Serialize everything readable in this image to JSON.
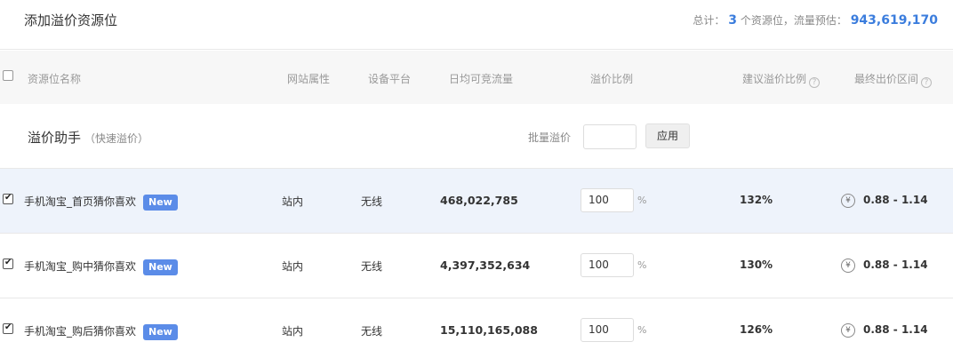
{
  "header": {
    "title": "添加溢价资源位",
    "summary_prefix": "总计：",
    "resource_count": "3",
    "summary_middle": "个资源位，流量预估：",
    "traffic_total": "943,619,170"
  },
  "table": {
    "columns": {
      "name": "资源位名称",
      "site": "网站属性",
      "platform": "设备平台",
      "daily_traffic": "日均可竞流量",
      "premium_ratio": "溢价比例",
      "suggested_ratio": "建议溢价比例",
      "final_range": "最终出价区间"
    }
  },
  "assistant": {
    "title": "溢价助手",
    "subtitle": "（快速溢价）",
    "batch_label": "批量溢价",
    "batch_value": "",
    "apply_label": "应用"
  },
  "rows": [
    {
      "name": "手机淘宝_首页猜你喜欢",
      "badge": "New",
      "site": "站内",
      "platform": "无线",
      "traffic": "468,022,785",
      "ratio": "100",
      "pct": "%",
      "suggested": "132%",
      "range": "0.88 - 1.14",
      "checked": true
    },
    {
      "name": "手机淘宝_购中猜你喜欢",
      "badge": "New",
      "site": "站内",
      "platform": "无线",
      "traffic": "4,397,352,634",
      "ratio": "100",
      "pct": "%",
      "suggested": "130%",
      "range": "0.88 - 1.14",
      "checked": true
    },
    {
      "name": "手机淘宝_购后猜你喜欢",
      "badge": "New",
      "site": "站内",
      "platform": "无线",
      "traffic": "15,110,165,088",
      "ratio": "100",
      "pct": "%",
      "suggested": "126%",
      "range": "0.88 - 1.14",
      "checked": true
    }
  ],
  "colors": {
    "accent": "#3b7ddd",
    "badge": "#5b8ce8",
    "highlight_row": "#eef3fb"
  },
  "icons": {
    "help": "help-circle-icon",
    "yen": "yen-circle-icon"
  }
}
